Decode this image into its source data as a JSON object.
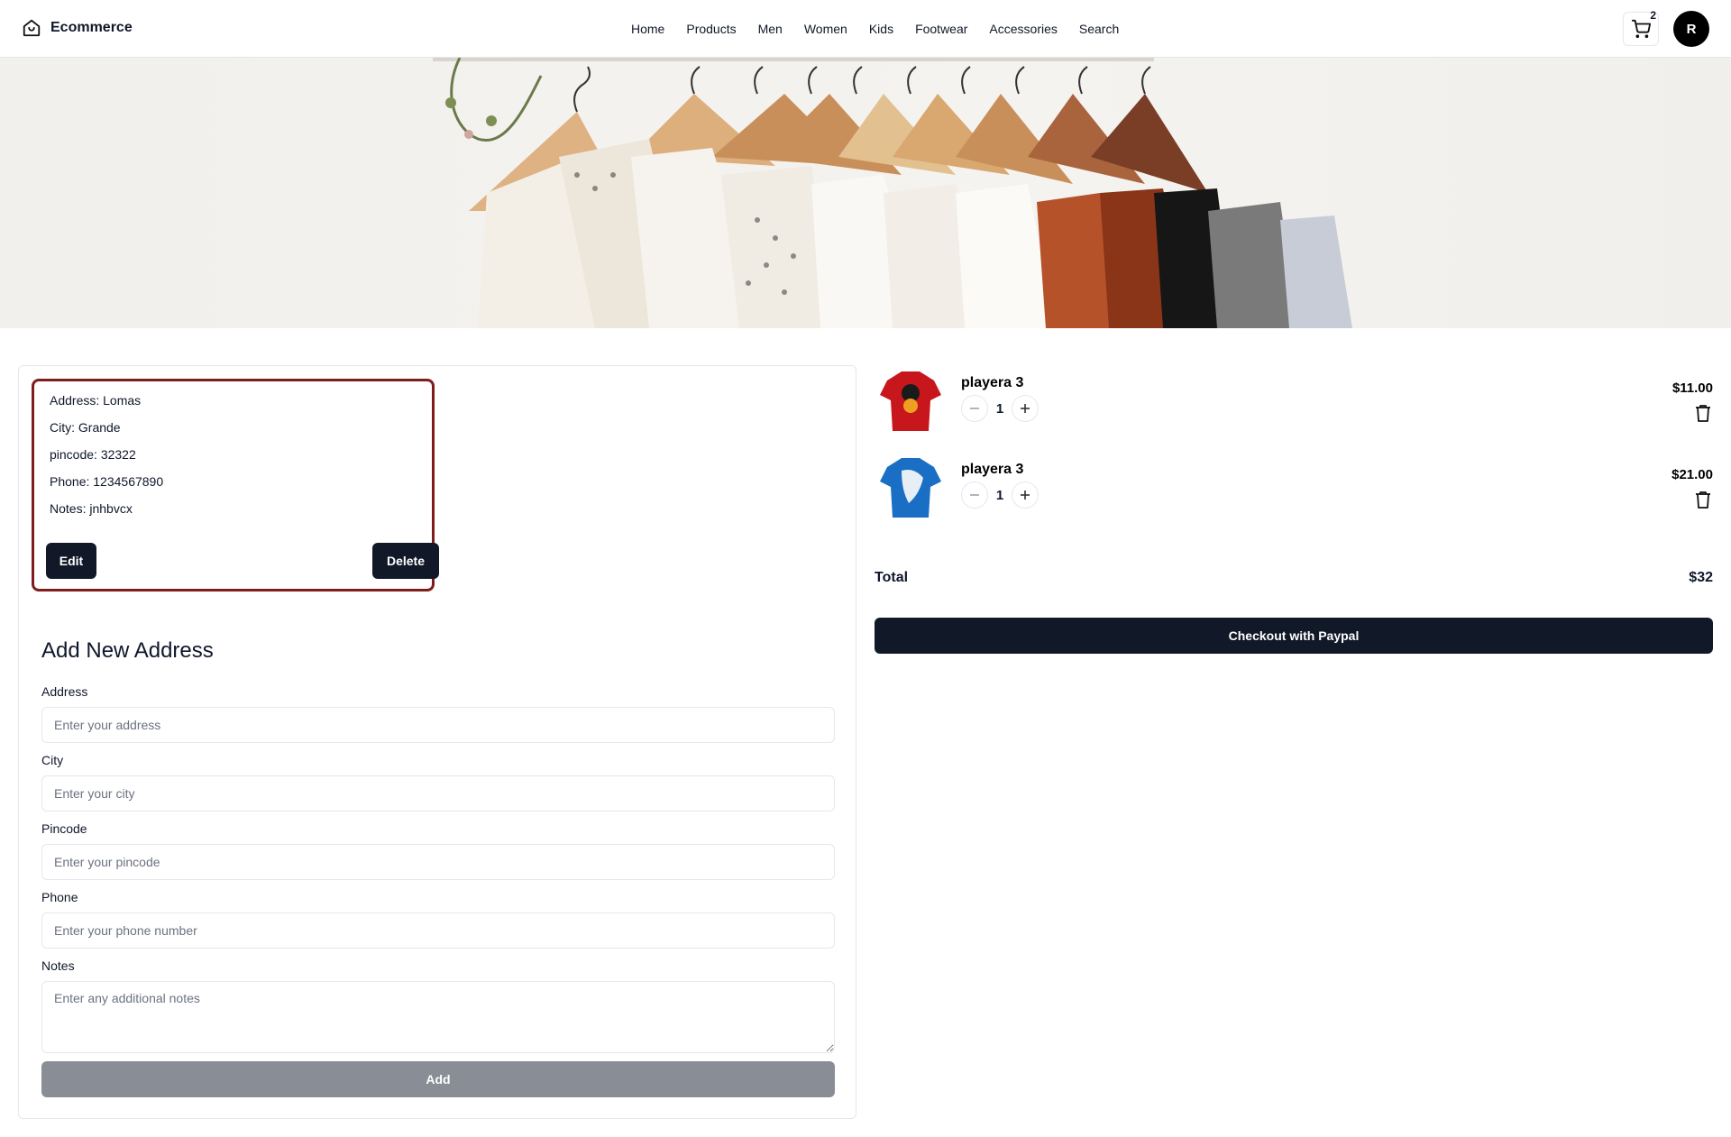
{
  "header": {
    "brand": "Ecommerce",
    "nav": [
      "Home",
      "Products",
      "Men",
      "Women",
      "Kids",
      "Footwear",
      "Accessories",
      "Search"
    ],
    "cart_count": "2",
    "avatar_initial": "R"
  },
  "saved_address": {
    "address": "Address: Lomas",
    "city": "City: Grande",
    "pincode": "pincode: 32322",
    "phone": "Phone: 1234567890",
    "notes": "Notes: jnhbvcx",
    "edit_label": "Edit",
    "delete_label": "Delete"
  },
  "form": {
    "title": "Add New Address",
    "fields": [
      {
        "label": "Address",
        "placeholder": "Enter your address"
      },
      {
        "label": "City",
        "placeholder": "Enter your city"
      },
      {
        "label": "Pincode",
        "placeholder": "Enter your pincode"
      },
      {
        "label": "Phone",
        "placeholder": "Enter your phone number"
      },
      {
        "label": "Notes",
        "placeholder": "Enter any additional notes"
      }
    ],
    "submit_label": "Add"
  },
  "cart": {
    "items": [
      {
        "name": "playera 3",
        "qty": "1",
        "price": "$11.00",
        "shirt_color": "#c8161d"
      },
      {
        "name": "playera 3",
        "qty": "1",
        "price": "$21.00",
        "shirt_color": "#1a6fc4"
      }
    ],
    "total_label": "Total",
    "total_value": "$32",
    "checkout_label": "Checkout with Paypal"
  },
  "colors": {
    "primary_dark": "#111827",
    "selected_border": "#7f1d1d",
    "add_button_disabled": "#898d96"
  }
}
